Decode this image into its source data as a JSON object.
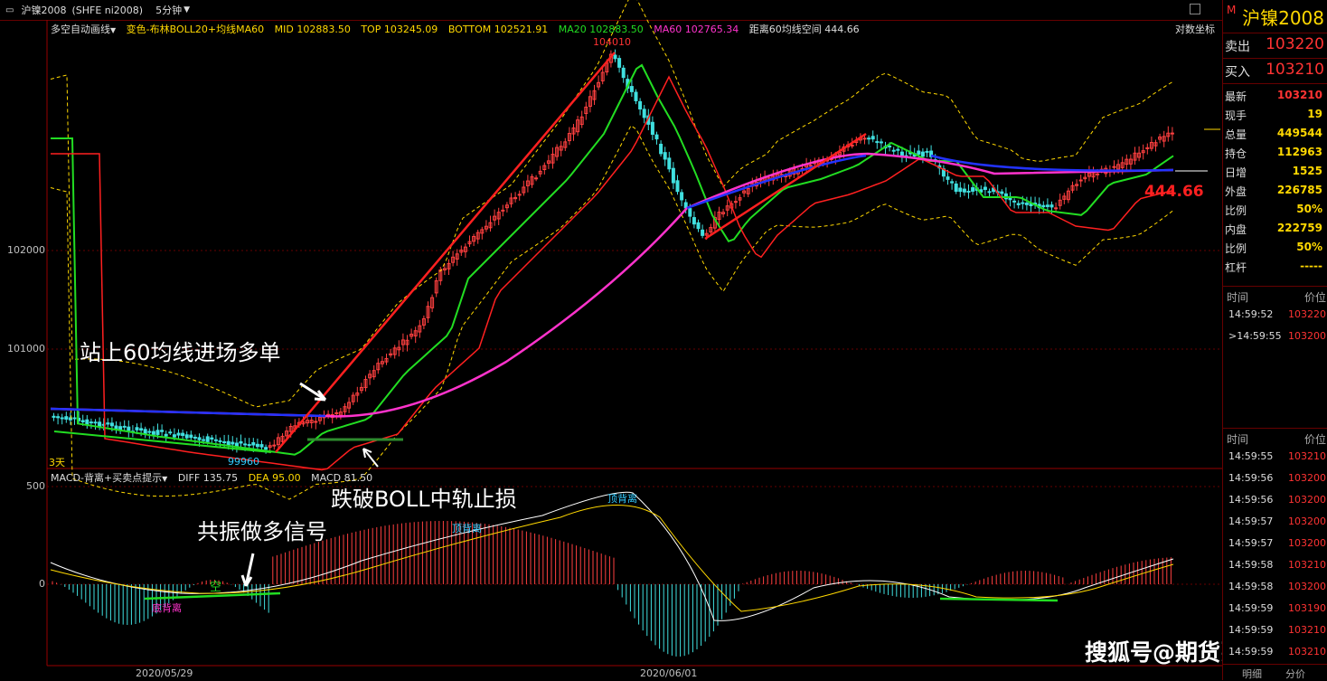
{
  "header": {
    "symbol": "沪镍2008",
    "code": "(SHFE ni2008)",
    "period": "5分钟"
  },
  "legend": {
    "indicator": "多空自动画线",
    "boll_label": "变色-布林BOLL20+均线MA60",
    "mid": "MID 102883.50",
    "top": "TOP 103245.09",
    "bottom": "BOTTOM 102521.91",
    "ma20": "MA20 102883.50",
    "ma60": "MA60 102765.34",
    "dist": "距离60均线空间 444.66"
  },
  "scale_button": "对数坐标",
  "y_ticks": [
    "102000",
    "101000"
  ],
  "macd_ticks": [
    "500",
    "0"
  ],
  "x_ticks": [
    "2020/05/29",
    "2020/06/01"
  ],
  "price_labels": {
    "high": "104010",
    "low": "99960",
    "dist_big": "444.66",
    "days": "3天"
  },
  "macd_legend": {
    "name": "MACD-背离+买卖点提示",
    "diff": "DIFF 135.75",
    "dea": "DEA 95.00",
    "macd": "MACD 81.50"
  },
  "macd_labels": {
    "bottom_div": "底背离",
    "top_div1": "顶背离",
    "top_div2": "顶背离",
    "kong": "空"
  },
  "notes": {
    "entry": "站上60均线进场多单",
    "stop": "跌破BOLL中轨止损",
    "resonance": "共振做多信号"
  },
  "watermark": "搜狐号@期货张睿",
  "side": {
    "title": "沪镍2008",
    "title_mark": "M",
    "sell_label": "卖出",
    "sell": "103220",
    "buy_label": "买入",
    "buy": "103210",
    "stats": [
      {
        "label": "最新",
        "value": "103210",
        "color": "#ff3333"
      },
      {
        "label": "现手",
        "value": "19",
        "color": "#ffd800"
      },
      {
        "label": "总量",
        "value": "449544",
        "color": "#ffd800"
      },
      {
        "label": "持仓",
        "value": "112963",
        "color": "#ffd800"
      },
      {
        "label": "日增",
        "value": "1525",
        "color": "#ffd800"
      },
      {
        "label": "外盘",
        "value": "226785",
        "color": "#ffd800"
      },
      {
        "label": "比例",
        "value": "50%",
        "color": "#ffd800"
      },
      {
        "label": "内盘",
        "value": "222759",
        "color": "#ffd800"
      },
      {
        "label": "比例",
        "value": "50%",
        "color": "#ffd800"
      },
      {
        "label": "杠杆",
        "value": "-----",
        "color": "#ffd800"
      }
    ],
    "col_time": "时间",
    "col_price": "价位",
    "trades1": [
      {
        "t": "14:59:52",
        "p": "103220"
      },
      {
        "t": ">14:59:55",
        "p": "103200"
      }
    ],
    "trades2": [
      {
        "t": "14:59:55",
        "p": "103210"
      },
      {
        "t": "14:59:56",
        "p": "103200"
      },
      {
        "t": "14:59:56",
        "p": "103200"
      },
      {
        "t": "14:59:57",
        "p": "103200"
      },
      {
        "t": "14:59:57",
        "p": "103200"
      },
      {
        "t": "14:59:58",
        "p": "103210"
      },
      {
        "t": "14:59:58",
        "p": "103200"
      },
      {
        "t": "14:59:59",
        "p": "103190"
      },
      {
        "t": "14:59:59",
        "p": "103210"
      },
      {
        "t": "14:59:59",
        "p": "103210"
      }
    ],
    "tab_detail": "明细",
    "tab_price": "分价"
  }
}
